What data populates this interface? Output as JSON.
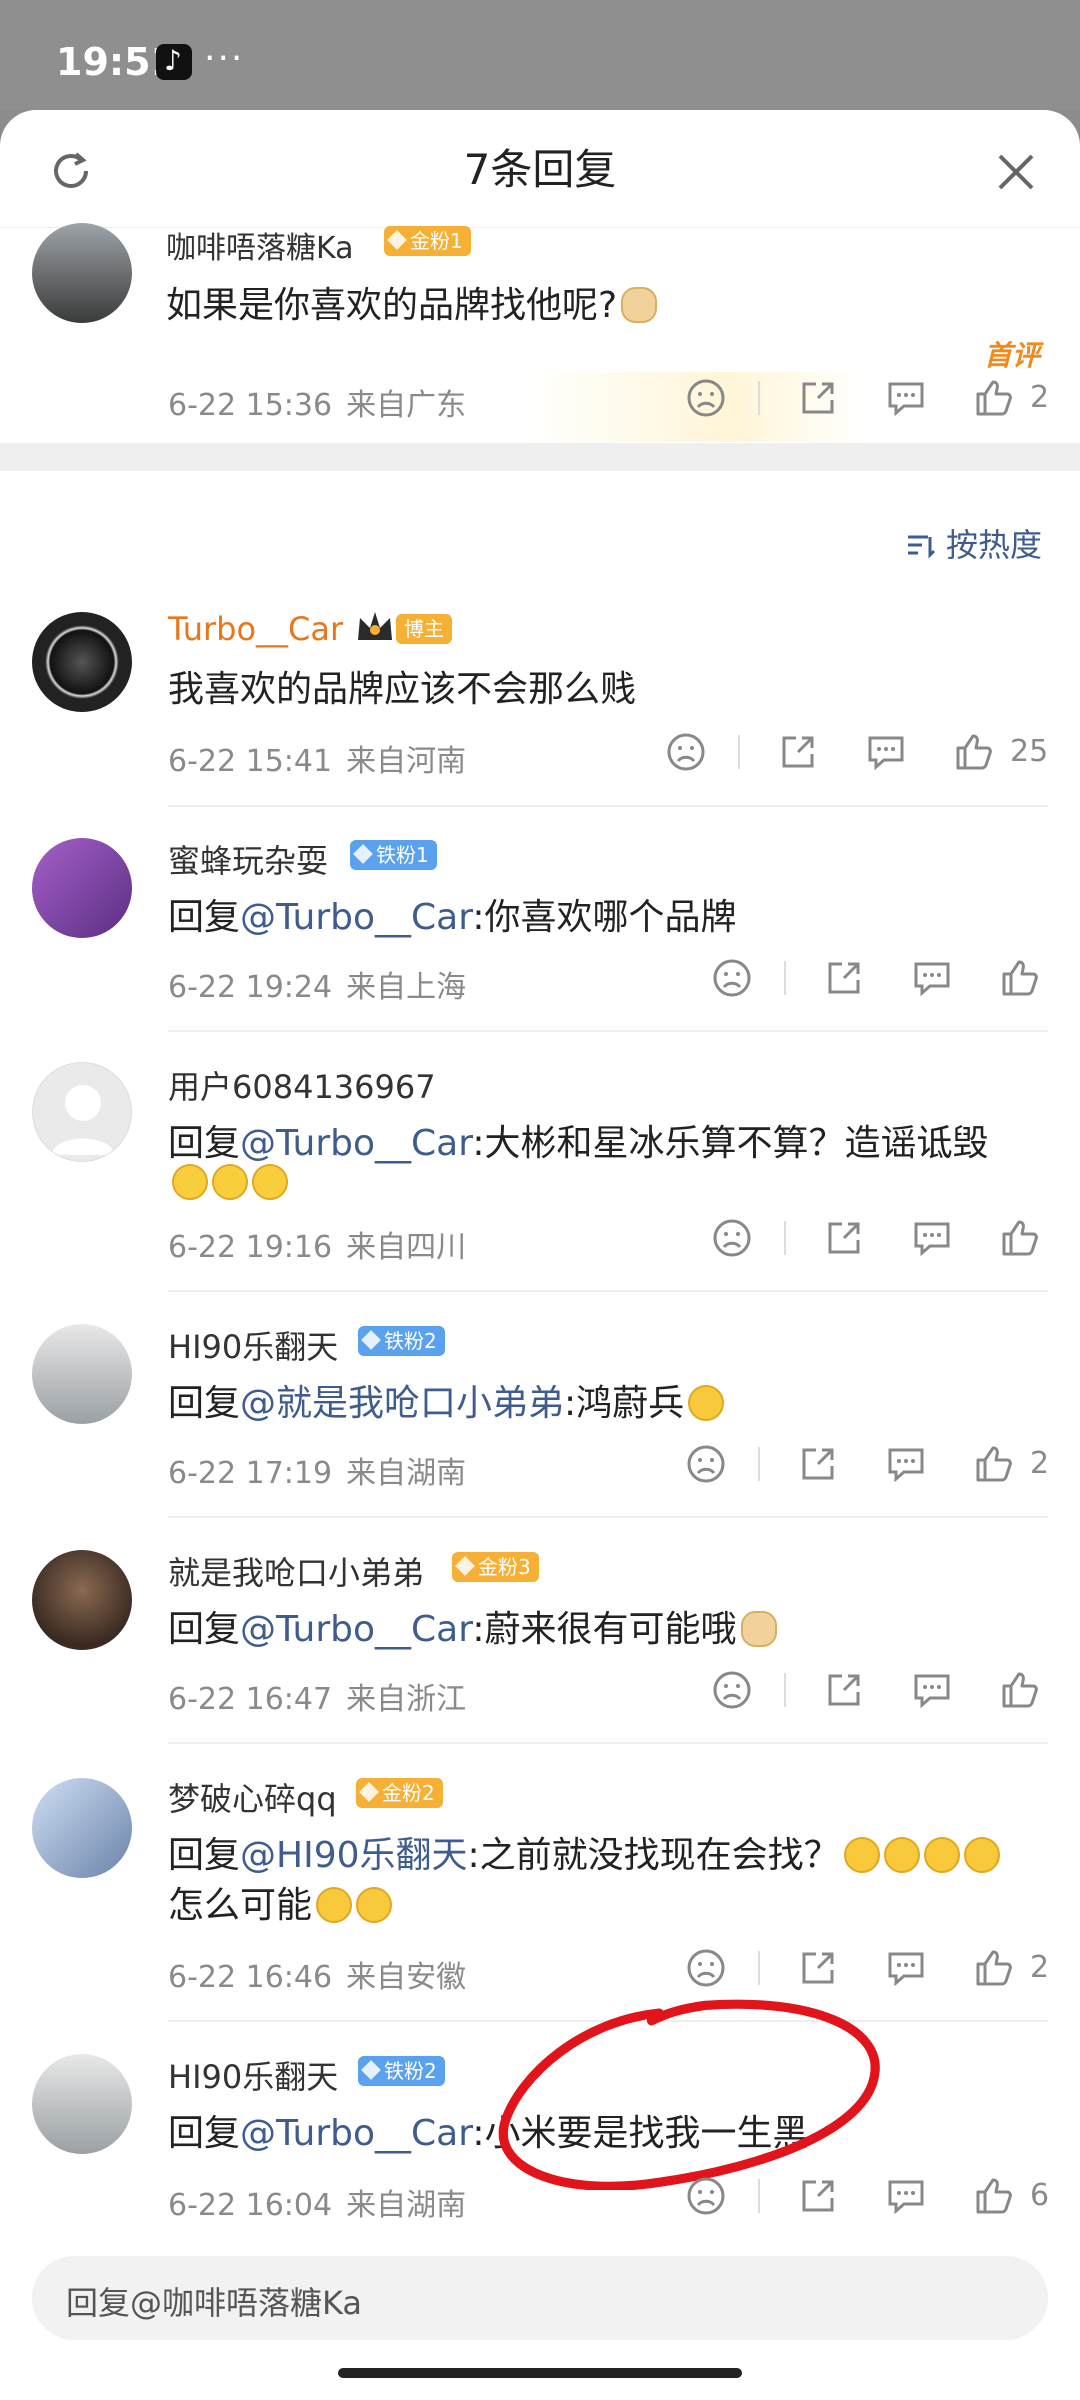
{
  "status_bar": {
    "time": "19:51",
    "more": "···"
  },
  "header": {
    "title": "7条回复"
  },
  "top_comment": {
    "username": "咖啡唔落糖Ka",
    "badge": "金粉1",
    "label": "首评",
    "text": "如果是你喜欢的品牌找他呢?",
    "date": "6-22 15:36",
    "location": "来自广东",
    "likes": "2"
  },
  "sort_label": "按热度",
  "replies": [
    {
      "username": "Turbo__Car",
      "badge": "博主",
      "text_plain": "我喜欢的品牌应该不会那么贱",
      "date": "6-22 15:41",
      "location": "来自河南",
      "likes": "25"
    },
    {
      "username": "蜜蜂玩杂耍",
      "badge": "铁粉1",
      "prefix": "回复",
      "at": "@Turbo__Car",
      "text": ":你喜欢哪个品牌",
      "date": "6-22 19:24",
      "location": "来自上海",
      "likes": ""
    },
    {
      "username": "用户6084136967",
      "badge": "",
      "prefix": "回复",
      "at": "@Turbo__Car",
      "text": ":大彬和星冰乐算不算？造谣诋毁",
      "date": "6-22 19:16",
      "location": "来自四川",
      "likes": ""
    },
    {
      "username": "HI90乐翻天",
      "badge": "铁粉2",
      "prefix": "回复",
      "at": "@就是我呛口小弟弟",
      "text": ":鸿蔚兵",
      "date": "6-22 17:19",
      "location": "来自湖南",
      "likes": "2"
    },
    {
      "username": "就是我呛口小弟弟",
      "badge": "金粉3",
      "prefix": "回复",
      "at": "@Turbo__Car",
      "text": ":蔚来很有可能哦",
      "date": "6-22 16:47",
      "location": "来自浙江",
      "likes": ""
    },
    {
      "username": "梦破心碎qq",
      "badge": "金粉2",
      "prefix": "回复",
      "at": "@HI90乐翻天",
      "text": ":之前就没找现在会找？",
      "text2": "怎么可能",
      "date": "6-22 16:46",
      "location": "来自安徽",
      "likes": "2"
    },
    {
      "username": "HI90乐翻天",
      "badge": "铁粉2",
      "prefix": "回复",
      "at": "@Turbo__Car",
      "text": ":小米要是找我一生黑",
      "date": "6-22 16:04",
      "location": "来自湖南",
      "likes": "6"
    }
  ],
  "reply_input": {
    "placeholder": "回复@咖啡唔落糖Ka"
  },
  "colors": {
    "link": "#3f5c8f",
    "blogger_name": "#e8771b",
    "gold_badge": "#f5b035",
    "blue_badge": "#5aa2ee",
    "annotation": "#e0141a"
  }
}
